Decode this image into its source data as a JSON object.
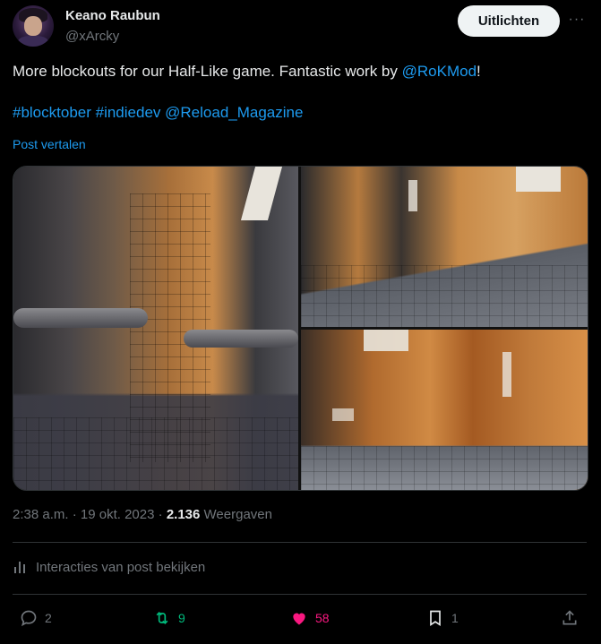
{
  "author": {
    "name": "Keano Raubun",
    "handle": "@xArcky"
  },
  "header": {
    "follow_label": "Uitlichten",
    "more_label": "···"
  },
  "tweet": {
    "text_before": "More blockouts for our Half-Like game. Fantastic work by ",
    "mention": "@RoKMod",
    "text_after": "!",
    "hashtag1": "#blocktober",
    "hashtag2": "#indiedev",
    "mention2": "@Reload_Magazine",
    "translate_label": "Post vertalen"
  },
  "meta": {
    "time": "2:38 a.m.",
    "sep1": " · ",
    "date": "19 okt. 2023",
    "sep2": " · ",
    "views": "2.136",
    "views_label": "Weergaven"
  },
  "interactions_label": "Interacties van post bekijken",
  "actions": {
    "replies": "2",
    "reposts": "9",
    "likes": "58",
    "bookmarks": "1"
  },
  "colors": {
    "link": "#1d9bf0",
    "repost": "#00ba7c",
    "like": "#f91880",
    "muted": "#71767b"
  }
}
